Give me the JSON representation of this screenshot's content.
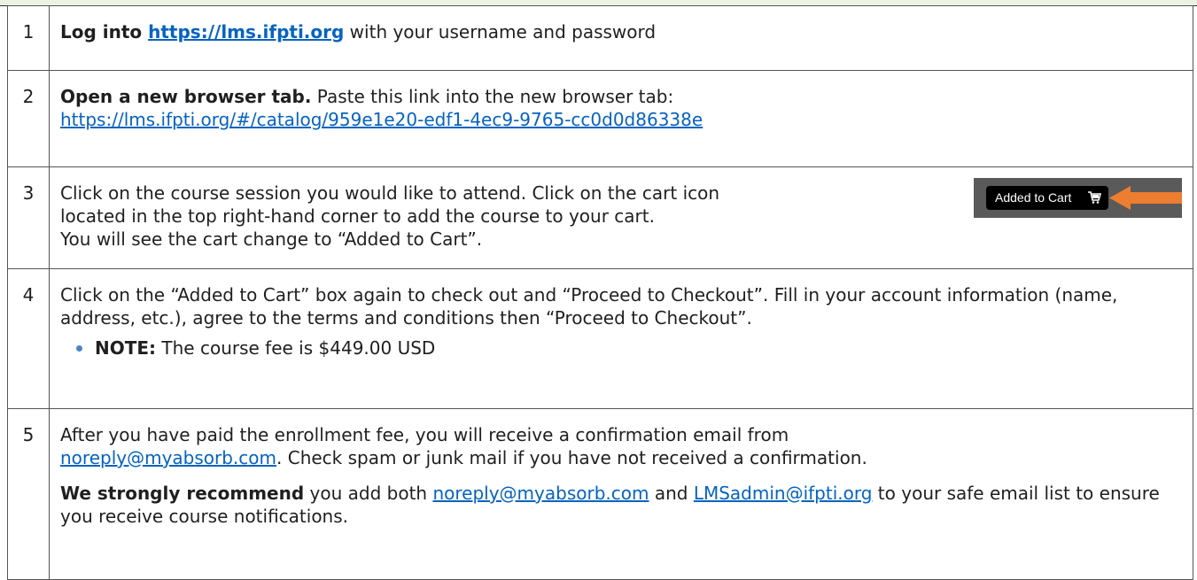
{
  "steps": [
    {
      "number": "1",
      "bold_lead": "Log into ",
      "link": "https://lms.ifpti.org",
      "rest": " with your username and password"
    },
    {
      "number": "2",
      "bold_lead": "Open a new browser tab.",
      "text": " Paste this link into the new browser tab:",
      "link": "https://lms.ifpti.org/#/catalog/959e1e20-edf1-4ec9-9765-cc0d0d86338e"
    },
    {
      "number": "3",
      "line1": "Click on the course session you would like to attend. Click on the cart icon",
      "line2": "located in the top right-hand corner to add the course to your cart.",
      "line3": "You will see the cart change to “Added to Cart”.",
      "cart_button_label": "Added to Cart"
    },
    {
      "number": "4",
      "text": "Click on the “Added to Cart” box again to check out and “Proceed to Checkout”. Fill in your account information (name, address, etc.), agree to the terms and conditions then “Proceed to Checkout”.",
      "note_label": "NOTE:",
      "note_text": " The course fee is $449.00 USD"
    },
    {
      "number": "5",
      "text1": "After you have paid the enrollment fee, you will receive a confirmation email from",
      "email1": "noreply@myabsorb.com",
      "text2": ". Check spam or junk mail if you have not received a confirmation.",
      "bold_lead2": "We strongly recommend",
      "text3": " you add both ",
      "email2": "noreply@myabsorb.com",
      "text4": " and ",
      "email3": "LMSadmin@ifpti.org",
      "text5": " to your safe email list to ensure you receive course notifications."
    }
  ],
  "colors": {
    "link": "#0563c1",
    "arrow": "#ed7d31",
    "bullet": "#4a86c5"
  },
  "icons": {
    "cart": "shopping-cart-icon",
    "arrow": "left-arrow-icon"
  }
}
